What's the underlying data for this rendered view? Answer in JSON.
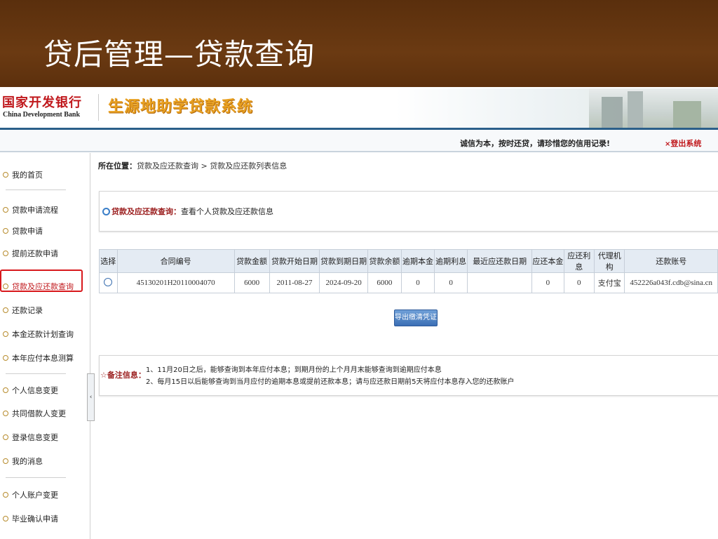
{
  "slide": {
    "title": "贷后管理—贷款查询"
  },
  "header": {
    "bank_name_cn": "国家开发银行",
    "bank_name_en": "China Development Bank",
    "system_title": "生源地助学贷款系统",
    "slogan": "诚信为本，按时还贷，请珍惜您的信用记录!",
    "logout_label": "登出系统",
    "logout_icon": "×"
  },
  "sidebar": {
    "items": [
      {
        "label": "我的首页"
      },
      {
        "label": "贷款申请流程"
      },
      {
        "label": "贷款申请"
      },
      {
        "label": "提前还款申请"
      },
      {
        "label": "贷款及应还款查询"
      },
      {
        "label": "还款记录"
      },
      {
        "label": "本金还款计划查询"
      },
      {
        "label": "本年应付本息测算"
      },
      {
        "label": "个人信息变更"
      },
      {
        "label": "共同借款人变更"
      },
      {
        "label": "登录信息变更"
      },
      {
        "label": "我的消息"
      },
      {
        "label": "个人账户变更"
      },
      {
        "label": "毕业确认申请"
      }
    ],
    "active_index": 4,
    "collapse_icon": "‹"
  },
  "breadcrumb": {
    "prefix": "所在位置：",
    "path": "贷款及应还款查询 > 贷款及应还款列表信息"
  },
  "query_panel": {
    "title": "贷款及应还款查询：",
    "desc": "查看个人贷款及应还款信息"
  },
  "table": {
    "headers": [
      "选择",
      "合同编号",
      "贷款金额",
      "贷款开始日期",
      "贷款到期日期",
      "贷款余额",
      "逾期本金",
      "逾期利息",
      "最近应还款日期",
      "应还本金",
      "应还利息",
      "代理机构",
      "还款账号"
    ],
    "rows": [
      {
        "contract_no": "45130201H20110004070",
        "amount": "6000",
        "start_date": "2011-08-27",
        "end_date": "2024-09-20",
        "balance": "6000",
        "overdue_principal": "0",
        "overdue_interest": "0",
        "recent_due_date": "",
        "due_principal": "0",
        "due_interest": "0",
        "agency": "支付宝",
        "account": "452226a043f.cdb@sina.cn"
      }
    ]
  },
  "export_button": {
    "label": "导出缴清凭证"
  },
  "notes": {
    "label": "备注信息：",
    "icon": "☆",
    "lines": [
      "1、11月20日之后，能够查询到本年应付本息；到期月份的上个月月末能够查询到逾期应付本息",
      "2、每月15日以后能够查询到当月应付的逾期本息或提前还款本息；请与应还款日期前5天将应付本息存入您的还款账户"
    ]
  }
}
